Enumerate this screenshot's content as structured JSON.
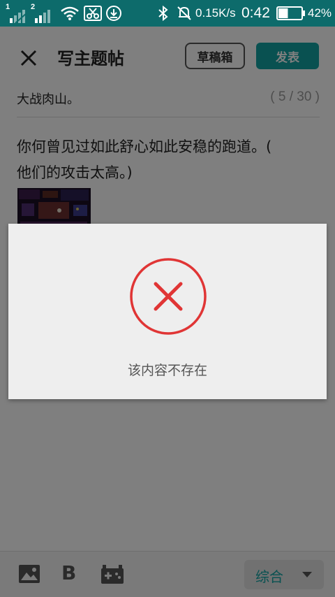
{
  "status_bar": {
    "sim1_label": "1",
    "sim2_label": "2",
    "net_speed": "0.15K/s",
    "time": "0:42",
    "battery": "42%",
    "battery_level": 0.42,
    "icons": [
      "signal-icon",
      "signal-icon",
      "wifi-icon",
      "scissors-icon",
      "download-icon",
      "bluetooth-icon",
      "notifications-off-icon",
      "battery-icon"
    ]
  },
  "header": {
    "title": "写主题帖",
    "draft_label": "草稿箱",
    "publish_label": "发表"
  },
  "post": {
    "title_value": "大战肉山。",
    "title_counter": "( 5 / 30 )",
    "body_line1": "你何曾见过如此舒心如此安稳的跑道。(",
    "body_line2": "他们的攻击太高。)"
  },
  "toolbar": {
    "icons": [
      "image-icon",
      "bold-icon",
      "gamepad-icon"
    ],
    "bold_glyph": "B",
    "category_label": "综合"
  },
  "dialog": {
    "message": "该内容不存在",
    "icon": "error-x-icon"
  },
  "colors": {
    "status_bar": "#0d6b6b",
    "accent": "#12a3a3",
    "error": "#e03535"
  }
}
